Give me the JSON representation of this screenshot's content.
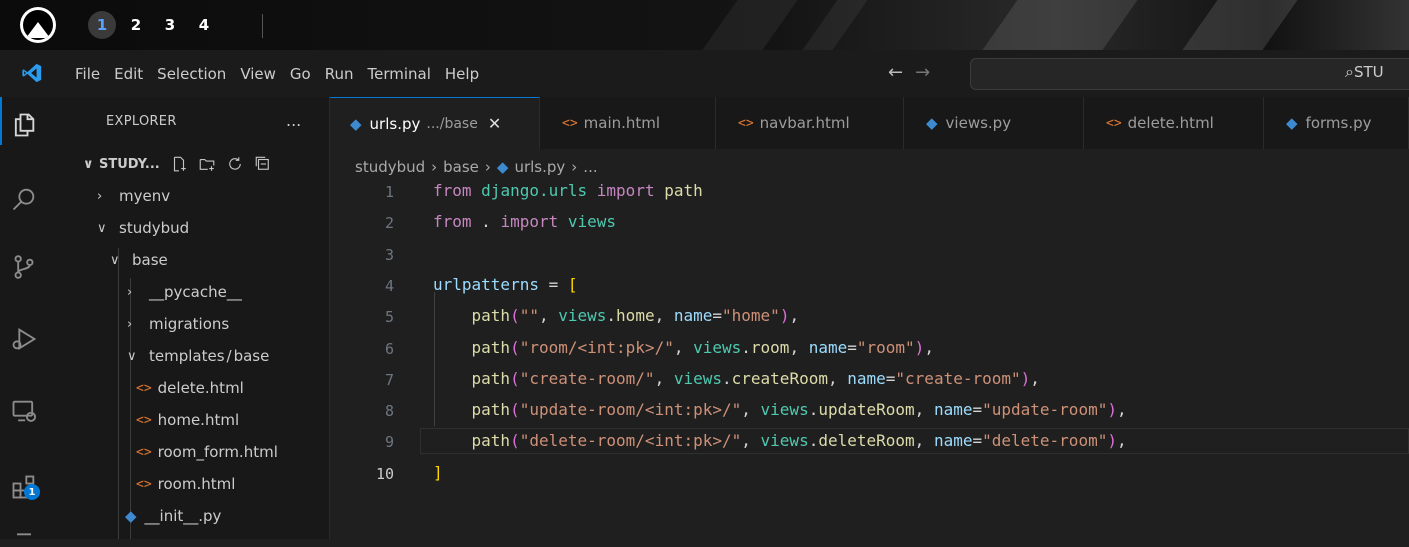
{
  "os": {
    "workspaces": [
      "1",
      "2",
      "3",
      "4"
    ],
    "active_workspace": "1"
  },
  "menubar": {
    "items": [
      "File",
      "Edit",
      "Selection",
      "View",
      "Go",
      "Run",
      "Terminal",
      "Help"
    ],
    "search_text": "STU"
  },
  "activitybar": {
    "badge": "1"
  },
  "explorer": {
    "title": "EXPLORER",
    "more": "...",
    "root": "STUDY...",
    "tree": [
      {
        "label": "myenv",
        "type": "folder-closed"
      },
      {
        "label": "studybud",
        "type": "folder-open"
      },
      {
        "label": "base",
        "type": "folder-open"
      },
      {
        "label": "__pycache__",
        "type": "folder-closed"
      },
      {
        "label": "migrations",
        "type": "folder-closed"
      },
      {
        "label": "templates",
        "label2": "base",
        "type": "folder-open"
      },
      {
        "label": "delete.html",
        "type": "html"
      },
      {
        "label": "home.html",
        "type": "html"
      },
      {
        "label": "room_form.html",
        "type": "html"
      },
      {
        "label": "room.html",
        "type": "html"
      },
      {
        "label": "__init__.py",
        "type": "py"
      }
    ]
  },
  "tabs": [
    {
      "label": "urls.py",
      "desc": ".../base",
      "icon": "python-icon",
      "active": true
    },
    {
      "label": "main.html",
      "icon": "html-icon"
    },
    {
      "label": "navbar.html",
      "icon": "html-icon"
    },
    {
      "label": "views.py",
      "icon": "python-icon"
    },
    {
      "label": "delete.html",
      "icon": "html-icon"
    },
    {
      "label": "forms.py",
      "icon": "python-icon"
    }
  ],
  "breadcrumb": {
    "parts": [
      "studybud",
      "base",
      "urls.py",
      "..."
    ]
  },
  "editor": {
    "line_numbers": [
      "1",
      "2",
      "3",
      "4",
      "5",
      "6",
      "7",
      "8",
      "9",
      "10"
    ],
    "current_line": "10",
    "lines": [
      [
        [
          "kw",
          "from"
        ],
        [
          "op",
          " "
        ],
        [
          "mod",
          "django.urls"
        ],
        [
          "op",
          " "
        ],
        [
          "kw",
          "import"
        ],
        [
          "op",
          " "
        ],
        [
          "fn",
          "path"
        ]
      ],
      [
        [
          "kw",
          "from"
        ],
        [
          "op",
          " . "
        ],
        [
          "kw",
          "import"
        ],
        [
          "op",
          " "
        ],
        [
          "mod",
          "views"
        ]
      ],
      [],
      [
        [
          "var",
          "urlpatterns"
        ],
        [
          "op",
          " = "
        ],
        [
          "br1",
          "["
        ]
      ],
      [
        [
          "op",
          "    "
        ],
        [
          "fn",
          "path"
        ],
        [
          "br2",
          "("
        ],
        [
          "str",
          "\"\""
        ],
        [
          "op",
          ", "
        ],
        [
          "mod",
          "views"
        ],
        [
          "op",
          "."
        ],
        [
          "fn",
          "home"
        ],
        [
          "op",
          ", "
        ],
        [
          "var",
          "name"
        ],
        [
          "op",
          "="
        ],
        [
          "str",
          "\"home\""
        ],
        [
          "br2",
          ")"
        ],
        [
          "op",
          ","
        ]
      ],
      [
        [
          "op",
          "    "
        ],
        [
          "fn",
          "path"
        ],
        [
          "br2",
          "("
        ],
        [
          "str",
          "\"room/<int:pk>/\""
        ],
        [
          "op",
          ", "
        ],
        [
          "mod",
          "views"
        ],
        [
          "op",
          "."
        ],
        [
          "fn",
          "room"
        ],
        [
          "op",
          ", "
        ],
        [
          "var",
          "name"
        ],
        [
          "op",
          "="
        ],
        [
          "str",
          "\"room\""
        ],
        [
          "br2",
          ")"
        ],
        [
          "op",
          ","
        ]
      ],
      [
        [
          "op",
          "    "
        ],
        [
          "fn",
          "path"
        ],
        [
          "br2",
          "("
        ],
        [
          "str",
          "\"create-room/\""
        ],
        [
          "op",
          ", "
        ],
        [
          "mod",
          "views"
        ],
        [
          "op",
          "."
        ],
        [
          "fn",
          "createRoom"
        ],
        [
          "op",
          ", "
        ],
        [
          "var",
          "name"
        ],
        [
          "op",
          "="
        ],
        [
          "str",
          "\"create-room\""
        ],
        [
          "br2",
          ")"
        ],
        [
          "op",
          ","
        ]
      ],
      [
        [
          "op",
          "    "
        ],
        [
          "fn",
          "path"
        ],
        [
          "br2",
          "("
        ],
        [
          "str",
          "\"update-room/<int:pk>/\""
        ],
        [
          "op",
          ", "
        ],
        [
          "mod",
          "views"
        ],
        [
          "op",
          "."
        ],
        [
          "fn",
          "updateRoom"
        ],
        [
          "op",
          ", "
        ],
        [
          "var",
          "name"
        ],
        [
          "op",
          "="
        ],
        [
          "str",
          "\"update-room\""
        ],
        [
          "br2",
          ")"
        ],
        [
          "op",
          ","
        ]
      ],
      [
        [
          "op",
          "    "
        ],
        [
          "fn",
          "path"
        ],
        [
          "br2",
          "("
        ],
        [
          "str",
          "\"delete-room/<int:pk>/\""
        ],
        [
          "op",
          ", "
        ],
        [
          "mod",
          "views"
        ],
        [
          "op",
          "."
        ],
        [
          "fn",
          "deleteRoom"
        ],
        [
          "op",
          ", "
        ],
        [
          "var",
          "name"
        ],
        [
          "op",
          "="
        ],
        [
          "str",
          "\"delete-room\""
        ],
        [
          "br2",
          ")"
        ],
        [
          "op",
          ","
        ]
      ],
      [
        [
          "br1",
          "]"
        ]
      ]
    ]
  },
  "colors": {
    "accent": "#0078d4",
    "keyword": "#c586c0",
    "module": "#4ec9b0",
    "function": "#dcdcaa",
    "string": "#ce9178",
    "variable": "#9cdcfe",
    "bracket1": "#ffd700",
    "bracket2": "#da70d6"
  }
}
